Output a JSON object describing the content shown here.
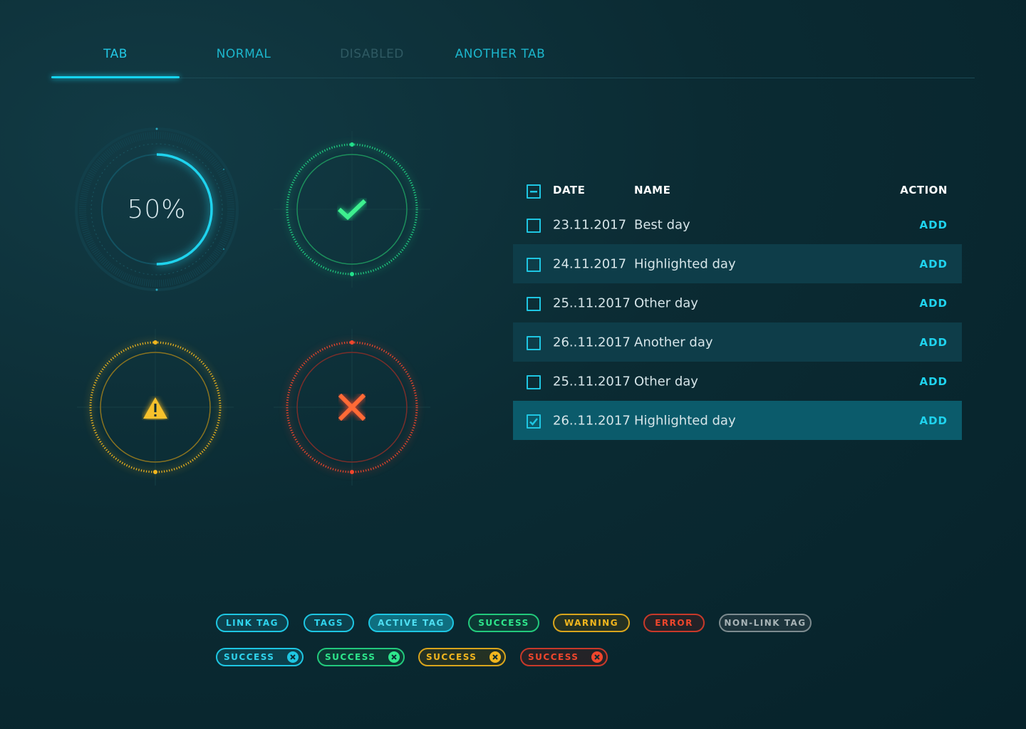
{
  "tabs": [
    {
      "label": "TAB",
      "state": "active"
    },
    {
      "label": "NORMAL",
      "state": "normal"
    },
    {
      "label": "DISABLED",
      "state": "disabled"
    },
    {
      "label": "ANOTHER TAB",
      "state": "normal"
    }
  ],
  "indicators": {
    "progress": {
      "text": "50%",
      "value": 0.5,
      "color": "#1fd3ee"
    },
    "success": {
      "icon": "check-icon",
      "color": "#22e08a"
    },
    "warning": {
      "icon": "warning-icon",
      "color": "#f2b61e"
    },
    "error": {
      "icon": "cross-icon",
      "color": "#f0462c"
    }
  },
  "table": {
    "headers": {
      "date": "DATE",
      "name": "NAME",
      "action": "ACTION"
    },
    "rows": [
      {
        "date": "23.11.2017",
        "name": "Best day",
        "action": "ADD",
        "checked": false,
        "style": "plain"
      },
      {
        "date": "24.11.2017",
        "name": "Highlighted day",
        "action": "ADD",
        "checked": false,
        "style": "highlight"
      },
      {
        "date": "25..11.2017",
        "name": "Other day",
        "action": "ADD",
        "checked": false,
        "style": "plain"
      },
      {
        "date": "26..11.2017",
        "name": "Another day",
        "action": "ADD",
        "checked": false,
        "style": "highlight"
      },
      {
        "date": "25..11.2017",
        "name": "Other day",
        "action": "ADD",
        "checked": false,
        "style": "plain"
      },
      {
        "date": "26..11.2017",
        "name": "Highlighted day",
        "action": "ADD",
        "checked": true,
        "style": "selected"
      }
    ]
  },
  "tags": {
    "row1": [
      {
        "label": "LINK TAG",
        "variant": "cyan"
      },
      {
        "label": "TAGS",
        "variant": "cyan"
      },
      {
        "label": "ACTIVE TAG",
        "variant": "cyan-active"
      },
      {
        "label": "SUCCESS",
        "variant": "green"
      },
      {
        "label": "WARNING",
        "variant": "yellow"
      },
      {
        "label": "ERROR",
        "variant": "red"
      },
      {
        "label": "NON-LINK TAG",
        "variant": "gray"
      }
    ],
    "row2": [
      {
        "label": "SUCCESS",
        "variant": "cyan"
      },
      {
        "label": "SUCCESS",
        "variant": "green"
      },
      {
        "label": "SUCCESS",
        "variant": "yellow"
      },
      {
        "label": "SUCCESS",
        "variant": "red"
      }
    ]
  },
  "colors": {
    "accent": "#1fd3ee",
    "success": "#22e08a",
    "warning": "#f2b61e",
    "error": "#f0462c",
    "gray": "#8a9a9e"
  }
}
